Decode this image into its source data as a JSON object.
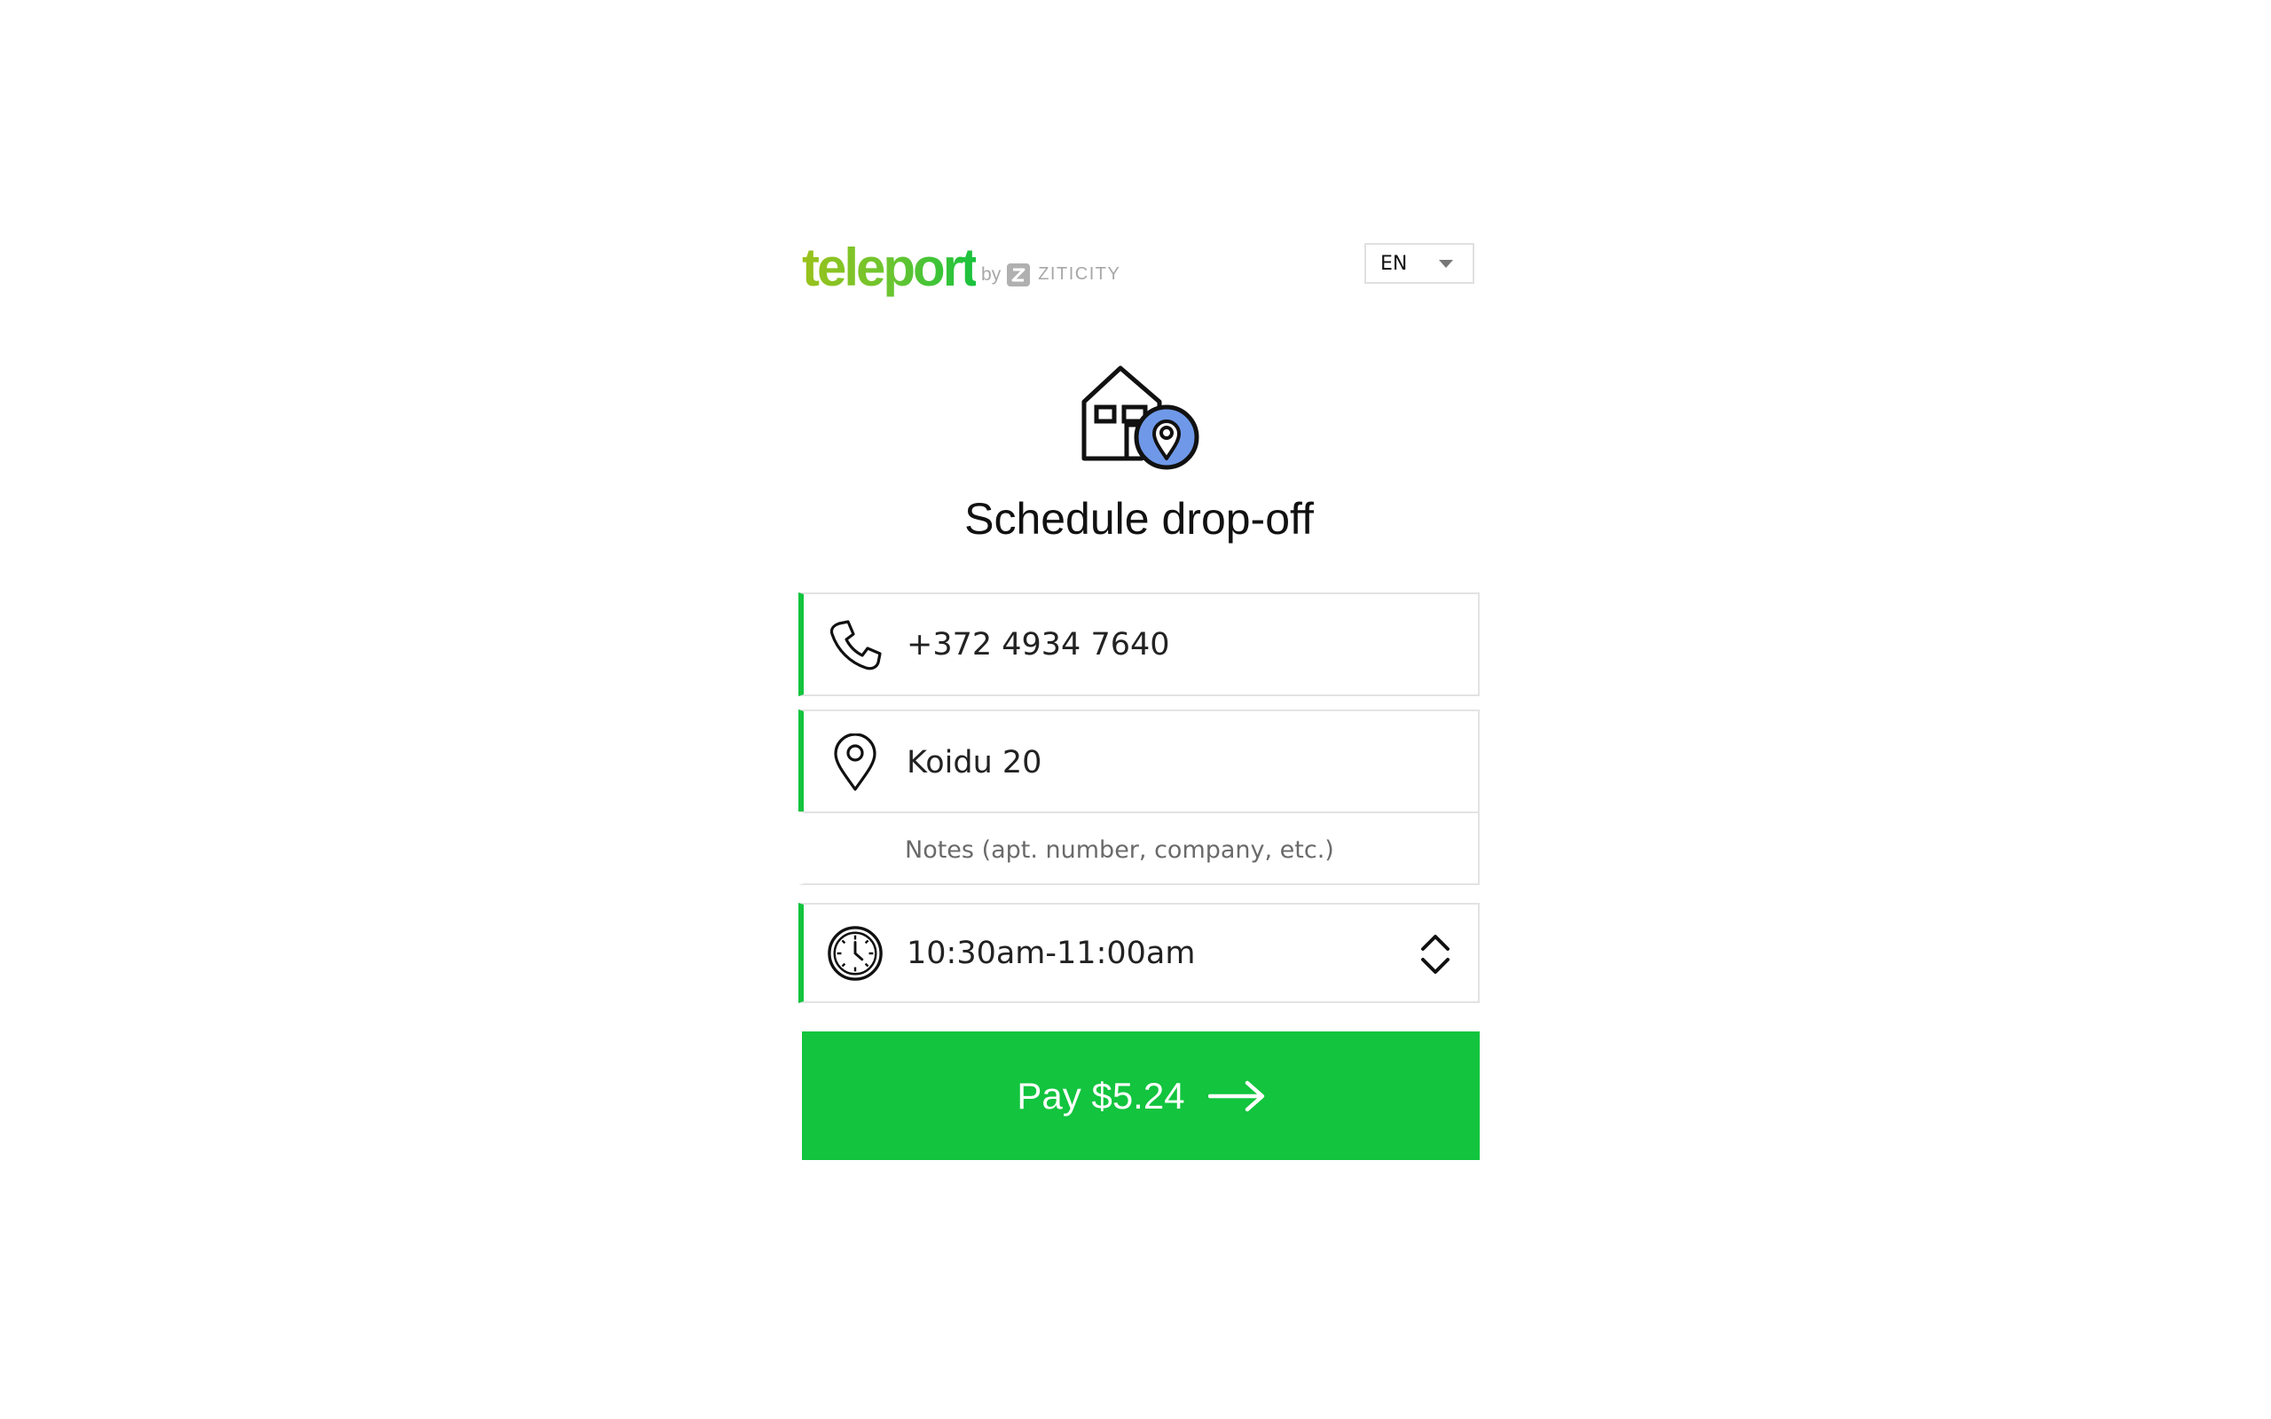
{
  "header": {
    "logo": {
      "brand": "teleport",
      "by": "by",
      "partner": "ZITICITY"
    },
    "language": {
      "selected": "EN"
    }
  },
  "hero": {
    "icon": "house-location-icon",
    "title": "Schedule drop-off"
  },
  "form": {
    "phone": {
      "icon": "phone-icon",
      "value": "+372 4934 7640"
    },
    "address": {
      "icon": "location-pin-icon",
      "value": "Koidu 20"
    },
    "notes": {
      "value": "",
      "placeholder": "Notes (apt. number, company, etc.)"
    },
    "time": {
      "icon": "clock-icon",
      "value": "10:30am-11:00am"
    }
  },
  "pay_button": {
    "label": "Pay $5.24",
    "icon": "arrow-right-icon"
  },
  "colors": {
    "accent": "#12c43e",
    "logo_start": "#9ac21c",
    "pin_blue": "#6f99e8",
    "border": "#e3e3e3"
  }
}
